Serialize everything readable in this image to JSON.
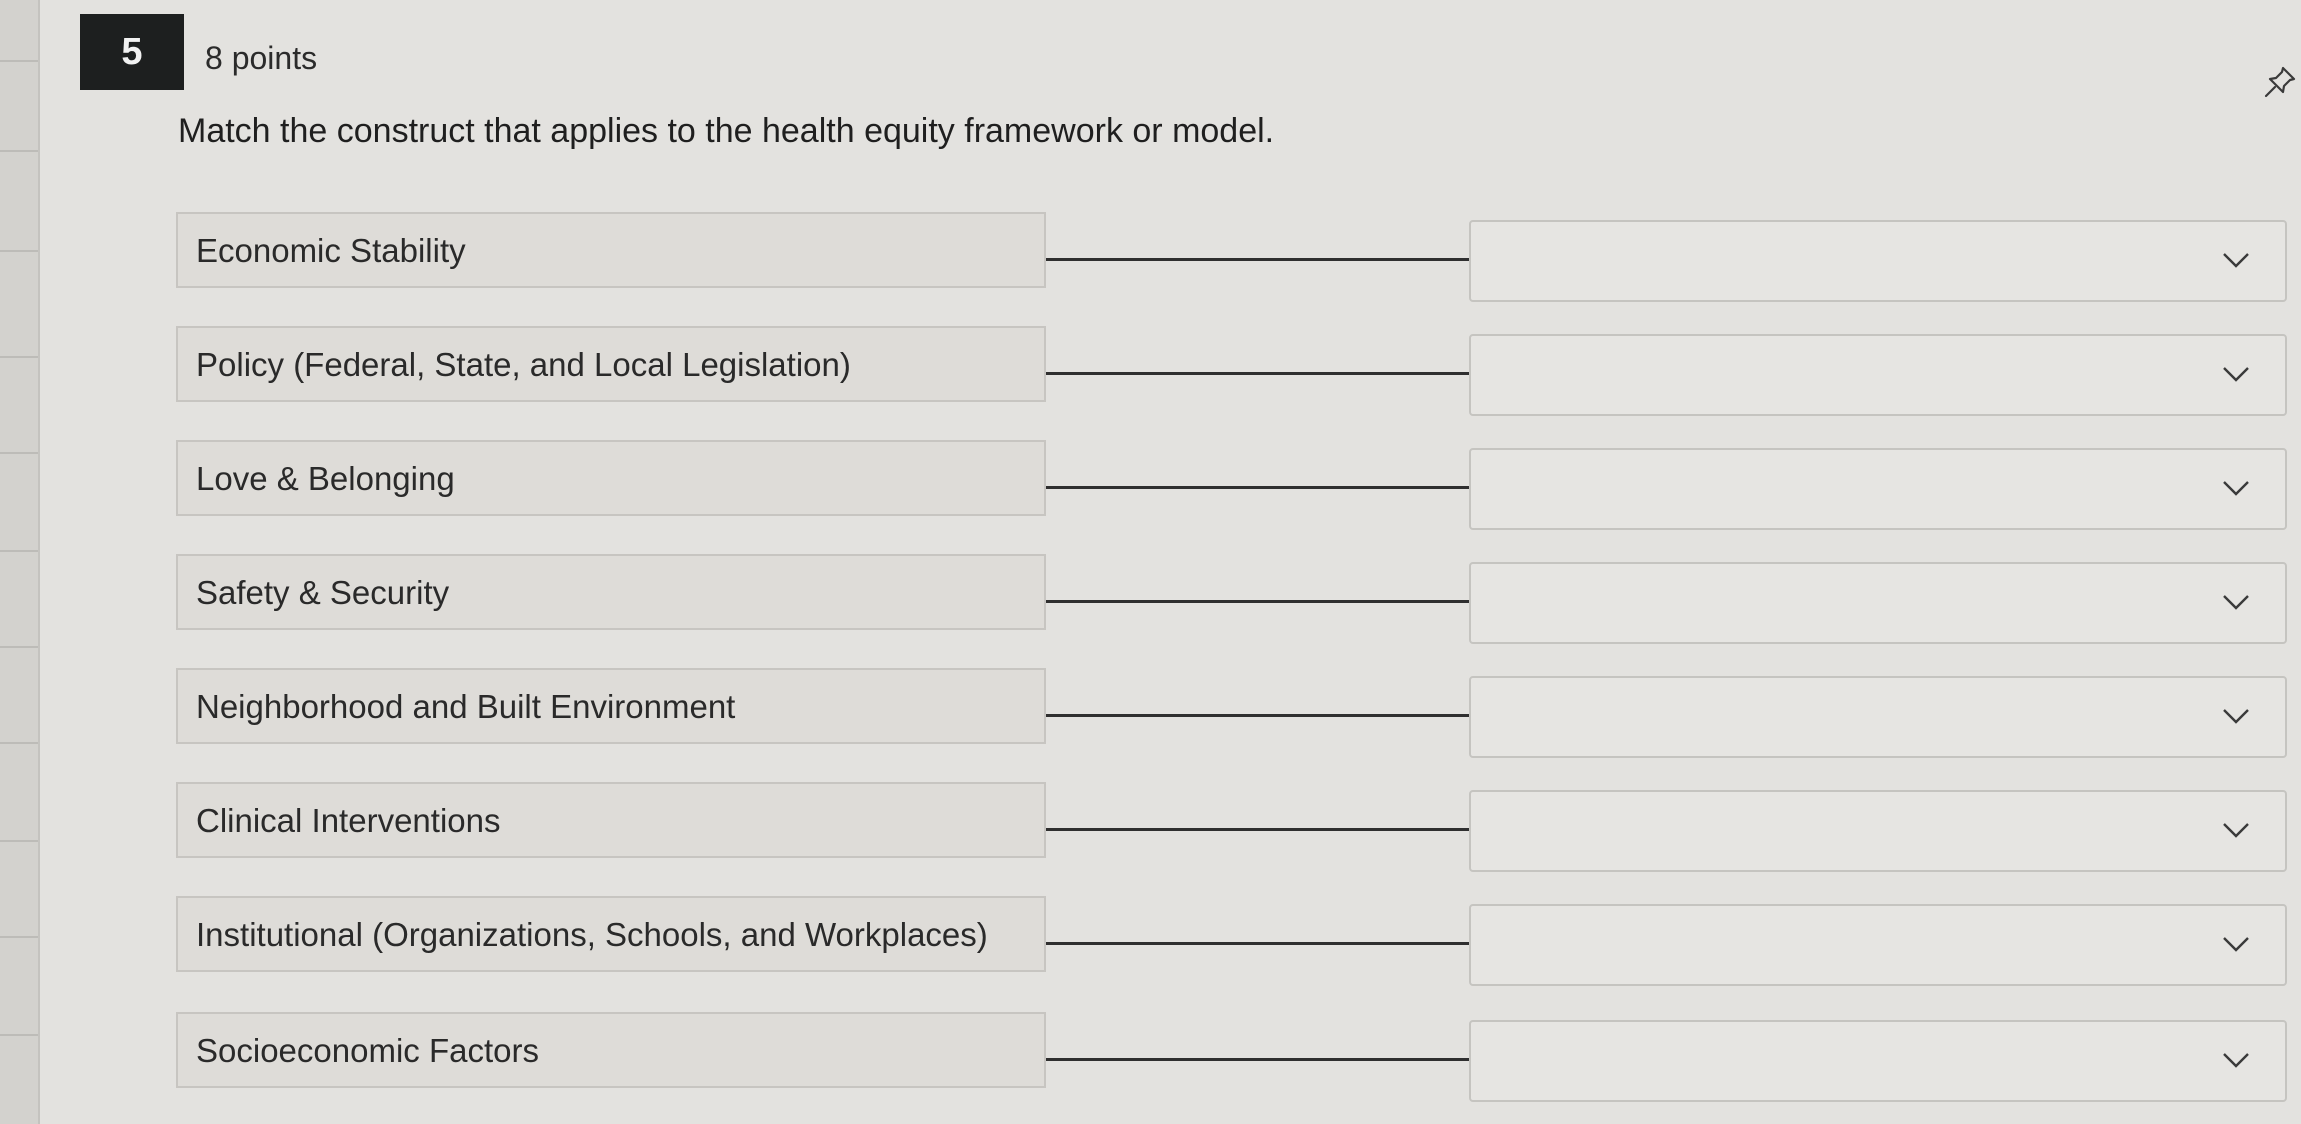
{
  "question": {
    "number": "5",
    "points": "8 points",
    "prompt": "Match the construct that applies to the health equity framework or model."
  },
  "icons": {
    "pin": "pin-icon",
    "dropdown": "chevron-down-icon"
  },
  "items": [
    {
      "term": "Economic Stability",
      "selected": ""
    },
    {
      "term": "Policy (Federal, State, and Local Legislation)",
      "selected": ""
    },
    {
      "term": "Love & Belonging",
      "selected": ""
    },
    {
      "term": "Safety & Security",
      "selected": ""
    },
    {
      "term": "Neighborhood and Built Environment",
      "selected": ""
    },
    {
      "term": "Clinical Interventions",
      "selected": ""
    },
    {
      "term": "Institutional (Organizations, Schools, and Workplaces)",
      "selected": ""
    },
    {
      "term": "Socioeconomic Factors",
      "selected": ""
    }
  ]
}
